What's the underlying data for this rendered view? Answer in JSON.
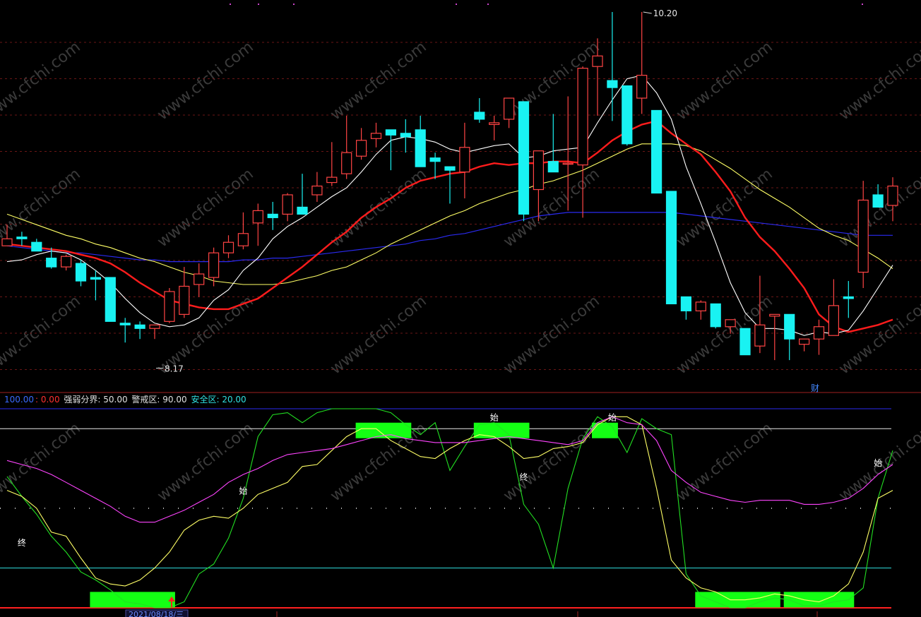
{
  "chart_data": [
    {
      "type": "candlestick",
      "annotations": {
        "high_label": "10.20",
        "low_label": "8.17",
        "event_marker": "财"
      },
      "series": [
        {
          "name": "",
          "values": []
        }
      ],
      "colors": {
        "up": "#ff4444",
        "down": "#19f2f2",
        "ma5": "#ffffff",
        "ma10": "#ff1c1c",
        "ma20": "#ffff66",
        "ma60": "#2a2af0",
        "grid": "#7a1a1a"
      },
      "ohlc": [
        [
          8.87,
          8.99,
          8.88,
          8.91
        ],
        [
          8.92,
          8.95,
          8.87,
          8.91
        ],
        [
          8.89,
          8.91,
          8.84,
          8.84
        ],
        [
          8.8,
          8.86,
          8.74,
          8.75
        ],
        [
          8.75,
          8.82,
          8.73,
          8.81
        ],
        [
          8.77,
          8.79,
          8.64,
          8.67
        ],
        [
          8.69,
          8.73,
          8.56,
          8.68
        ],
        [
          8.69,
          8.69,
          8.44,
          8.44
        ],
        [
          8.43,
          8.46,
          8.32,
          8.42
        ],
        [
          8.42,
          8.44,
          8.34,
          8.4
        ],
        [
          8.4,
          8.42,
          8.34,
          8.42
        ],
        [
          8.44,
          8.63,
          8.43,
          8.61
        ],
        [
          8.48,
          8.75,
          8.46,
          8.64
        ],
        [
          8.65,
          8.77,
          8.58,
          8.71
        ],
        [
          8.69,
          8.86,
          8.64,
          8.83
        ],
        [
          8.83,
          8.93,
          8.8,
          8.89
        ],
        [
          8.87,
          9.06,
          8.85,
          8.94
        ],
        [
          9.0,
          9.11,
          8.87,
          9.07
        ],
        [
          9.05,
          9.12,
          8.96,
          9.03
        ],
        [
          9.05,
          9.17,
          9.01,
          9.16
        ],
        [
          9.09,
          9.28,
          9.09,
          9.05
        ],
        [
          9.16,
          9.29,
          9.12,
          9.21
        ],
        [
          9.23,
          9.46,
          9.21,
          9.26
        ],
        [
          9.28,
          9.61,
          9.25,
          9.4
        ],
        [
          9.38,
          9.54,
          9.36,
          9.47
        ],
        [
          9.48,
          9.57,
          9.43,
          9.51
        ],
        [
          9.53,
          9.53,
          9.3,
          9.5
        ],
        [
          9.51,
          9.59,
          9.4,
          9.49
        ],
        [
          9.53,
          9.61,
          9.32,
          9.32
        ],
        [
          9.37,
          9.4,
          9.25,
          9.35
        ],
        [
          9.32,
          9.32,
          9.11,
          9.3
        ],
        [
          9.29,
          9.57,
          9.14,
          9.43
        ],
        [
          9.63,
          9.71,
          9.57,
          9.59
        ],
        [
          9.56,
          9.61,
          9.47,
          9.57
        ],
        [
          9.59,
          9.65,
          9.54,
          9.71
        ],
        [
          9.69,
          9.69,
          9.01,
          9.05
        ],
        [
          9.19,
          9.4,
          9.01,
          9.41
        ],
        [
          9.35,
          9.62,
          9.29,
          9.29
        ],
        [
          9.34,
          9.72,
          9.07,
          9.34
        ],
        [
          9.33,
          9.89,
          9.03,
          9.88
        ],
        [
          9.89,
          10.05,
          9.61,
          9.95
        ],
        [
          9.81,
          10.2,
          9.58,
          9.77
        ],
        [
          9.78,
          9.78,
          9.44,
          9.45
        ],
        [
          9.71,
          10.2,
          9.62,
          9.84
        ],
        [
          9.64,
          9.64,
          9.18,
          9.17
        ],
        [
          9.18,
          9.18,
          8.54,
          8.54
        ],
        [
          8.58,
          8.58,
          8.45,
          8.5
        ],
        [
          8.5,
          8.56,
          8.45,
          8.55
        ],
        [
          8.54,
          8.54,
          8.4,
          8.41
        ],
        [
          8.41,
          8.45,
          8.37,
          8.45
        ],
        [
          8.4,
          8.4,
          8.25,
          8.25
        ],
        [
          8.3,
          8.7,
          8.26,
          8.42
        ],
        [
          8.47,
          8.48,
          8.22,
          8.48
        ],
        [
          8.48,
          8.48,
          8.22,
          8.34
        ],
        [
          8.31,
          8.34,
          8.27,
          8.34
        ],
        [
          8.34,
          8.45,
          8.25,
          8.41
        ],
        [
          8.36,
          8.68,
          8.36,
          8.53
        ],
        [
          8.58,
          8.67,
          8.46,
          8.57
        ],
        [
          8.72,
          9.24,
          8.63,
          9.13
        ],
        [
          9.16,
          9.22,
          9.11,
          9.09
        ],
        [
          9.1,
          9.26,
          9.01,
          9.21
        ]
      ],
      "ma5": [
        8.78,
        8.79,
        8.82,
        8.84,
        8.83,
        8.79,
        8.73,
        8.66,
        8.57,
        8.49,
        8.43,
        8.41,
        8.42,
        8.46,
        8.56,
        8.62,
        8.73,
        8.8,
        8.91,
        8.98,
        9.03,
        9.09,
        9.15,
        9.2,
        9.29,
        9.39,
        9.47,
        9.49,
        9.48,
        9.46,
        9.42,
        9.4,
        9.42,
        9.44,
        9.45,
        9.37,
        9.38,
        9.41,
        9.42,
        9.43,
        9.57,
        9.7,
        9.82,
        9.84,
        9.74,
        9.59,
        9.32,
        9.11,
        8.89,
        8.66,
        8.49,
        8.4,
        8.4,
        8.39,
        8.36,
        8.38,
        8.37,
        8.39,
        8.5,
        8.63,
        8.76
      ],
      "ma10": [
        8.88,
        8.87,
        8.86,
        8.85,
        8.84,
        8.82,
        8.8,
        8.77,
        8.72,
        8.66,
        8.61,
        8.56,
        8.54,
        8.52,
        8.51,
        8.51,
        8.54,
        8.57,
        8.63,
        8.69,
        8.75,
        8.82,
        8.89,
        8.95,
        9.03,
        9.09,
        9.14,
        9.2,
        9.24,
        9.26,
        9.28,
        9.29,
        9.32,
        9.34,
        9.33,
        9.34,
        9.34,
        9.35,
        9.35,
        9.34,
        9.4,
        9.47,
        9.52,
        9.56,
        9.58,
        9.51,
        9.45,
        9.39,
        9.29,
        9.18,
        9.03,
        8.92,
        8.84,
        8.74,
        8.63,
        8.48,
        8.41,
        8.38,
        8.4,
        8.42,
        8.45
      ],
      "ma20": [
        9.05,
        9.02,
        8.99,
        8.96,
        8.93,
        8.91,
        8.88,
        8.86,
        8.83,
        8.8,
        8.78,
        8.75,
        8.72,
        8.7,
        8.67,
        8.66,
        8.65,
        8.65,
        8.65,
        8.66,
        8.68,
        8.7,
        8.73,
        8.75,
        8.79,
        8.83,
        8.88,
        8.92,
        8.96,
        9.0,
        9.04,
        9.07,
        9.11,
        9.14,
        9.17,
        9.19,
        9.22,
        9.24,
        9.27,
        9.3,
        9.34,
        9.38,
        9.42,
        9.45,
        9.45,
        9.45,
        9.44,
        9.41,
        9.36,
        9.31,
        9.25,
        9.19,
        9.14,
        9.09,
        9.03,
        8.97,
        8.93,
        8.9,
        8.85,
        8.8,
        8.74
      ],
      "ma60": [
        8.87,
        8.86,
        8.85,
        8.84,
        8.83,
        8.83,
        8.82,
        8.81,
        8.8,
        8.79,
        8.79,
        8.78,
        8.78,
        8.78,
        8.78,
        8.78,
        8.79,
        8.79,
        8.8,
        8.8,
        8.81,
        8.82,
        8.83,
        8.84,
        8.85,
        8.86,
        8.87,
        8.88,
        8.9,
        8.91,
        8.93,
        8.94,
        8.96,
        8.98,
        9.0,
        9.02,
        9.04,
        9.05,
        9.06,
        9.06,
        9.06,
        9.06,
        9.06,
        9.06,
        9.06,
        9.06,
        9.05,
        9.04,
        9.03,
        9.02,
        9.01,
        9.0,
        8.99,
        8.98,
        8.97,
        8.96,
        8.95,
        8.94,
        8.93,
        8.93,
        8.93
      ]
    },
    {
      "type": "line",
      "header": [
        {
          "text": "100.00",
          "color": "#3b6bff"
        },
        {
          "text": ": 0.00",
          "color": "#ff3030"
        },
        {
          "text": "  强弱分界: 50.00",
          "color": "#e0e0e0"
        },
        {
          "text": "  警戒区: 90.00",
          "color": "#e0e0e0"
        },
        {
          "text": "  安全区: 20.00",
          "color": "#2fe0e0"
        }
      ],
      "ylim": [
        0,
        100
      ],
      "reference_lines": [
        {
          "value": 100,
          "color": "#2a2af0"
        },
        {
          "value": 90,
          "color": "#e8e8e8"
        },
        {
          "value": 50,
          "color": "#bbbbbb",
          "dotted": true
        },
        {
          "value": 20,
          "color": "#2fe0e0"
        },
        {
          "value": 0,
          "color": "#ff2020"
        }
      ],
      "series": [
        {
          "name": "",
          "color": "#22e022",
          "values": [
            66,
            56,
            47,
            36,
            28,
            18,
            14,
            9,
            3,
            2,
            0,
            0,
            3,
            17,
            22,
            35,
            55,
            86,
            97,
            98,
            93,
            98,
            100,
            100,
            100,
            100,
            98,
            92,
            87,
            93,
            69,
            81,
            92,
            93,
            87,
            52,
            42,
            20,
            60,
            85,
            96,
            91,
            78,
            95,
            90,
            87,
            17,
            6,
            3,
            0,
            0,
            3,
            5,
            4,
            1,
            1,
            3,
            4,
            10,
            55,
            79
          ]
        },
        {
          "name": "",
          "color": "#ffff66",
          "values": [
            59,
            56,
            50,
            38,
            36,
            25,
            15,
            12,
            11,
            14,
            20,
            28,
            39,
            44,
            46,
            45,
            50,
            57,
            60,
            63,
            71,
            72,
            79,
            86,
            90,
            90,
            84,
            80,
            76,
            75,
            80,
            84,
            87,
            86,
            81,
            75,
            76,
            80,
            81,
            83,
            92,
            96,
            96,
            92,
            60,
            24,
            15,
            10,
            8,
            4,
            4,
            5,
            7,
            6,
            4,
            3,
            6,
            12,
            28,
            55,
            59
          ]
        },
        {
          "name": "",
          "color": "#ff44ff",
          "values": [
            74,
            72,
            70,
            67,
            63,
            59,
            55,
            51,
            46,
            43,
            43,
            46,
            49,
            53,
            57,
            63,
            67,
            70,
            74,
            77,
            78,
            79,
            80,
            82,
            84,
            86,
            87,
            85,
            84,
            83,
            83,
            83,
            84,
            85,
            86,
            85,
            84,
            83,
            82,
            84,
            93,
            96,
            93,
            92,
            84,
            69,
            63,
            58,
            56,
            54,
            53,
            54,
            54,
            54,
            52,
            52,
            53,
            55,
            60,
            67,
            72
          ]
        }
      ],
      "text_annotations": [
        {
          "text": "终",
          "index": 1,
          "value": 33
        },
        {
          "text": "始",
          "index": 16,
          "value": 59
        },
        {
          "text": "始",
          "index": 33,
          "value": 96
        },
        {
          "text": "终",
          "index": 35,
          "value": 66
        },
        {
          "text": "始",
          "index": 41,
          "value": 96
        },
        {
          "text": "始",
          "index": 59,
          "value": 73
        }
      ],
      "highlight_blocks": [
        {
          "from": 6,
          "to": 11,
          "level": "bottom"
        },
        {
          "from": 24,
          "to": 27,
          "level": "top"
        },
        {
          "from": 32,
          "to": 35,
          "level": "top"
        },
        {
          "from": 40,
          "to": 41,
          "level": "top"
        },
        {
          "from": 47,
          "to": 52,
          "level": "bottom"
        },
        {
          "from": 53,
          "to": 57,
          "level": "bottom"
        }
      ],
      "date_label": "2021/08/18/三"
    }
  ],
  "watermark": "www.cfchi.com"
}
